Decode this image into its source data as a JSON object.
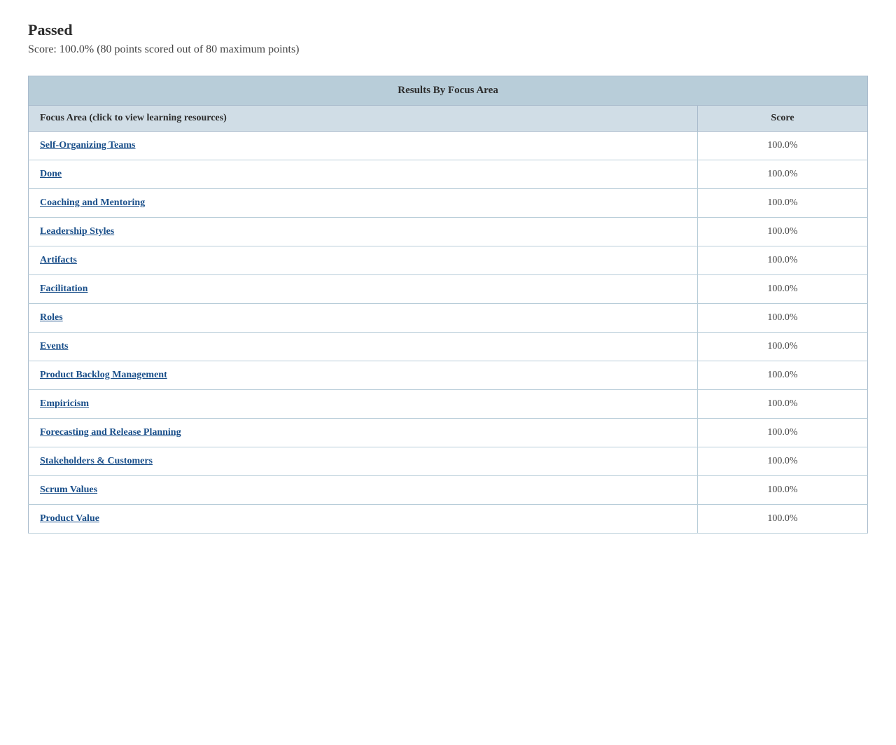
{
  "status": {
    "title": "Passed",
    "score_text": "Score: 100.0% (80 points scored out of 80 maximum points)"
  },
  "table": {
    "section_header": "Results By Focus Area",
    "col_focus_area": "Focus Area (click to view learning resources)",
    "col_score": "Score",
    "rows": [
      {
        "focus_area": "Self-Organizing Teams",
        "score": "100.0%"
      },
      {
        "focus_area": "Done",
        "score": "100.0%"
      },
      {
        "focus_area": "Coaching and Mentoring",
        "score": "100.0%"
      },
      {
        "focus_area": "Leadership Styles",
        "score": "100.0%"
      },
      {
        "focus_area": "Artifacts",
        "score": "100.0%"
      },
      {
        "focus_area": "Facilitation",
        "score": "100.0%"
      },
      {
        "focus_area": "Roles",
        "score": "100.0%"
      },
      {
        "focus_area": "Events",
        "score": "100.0%"
      },
      {
        "focus_area": "Product Backlog Management",
        "score": "100.0%"
      },
      {
        "focus_area": "Empiricism",
        "score": "100.0%"
      },
      {
        "focus_area": "Forecasting and Release Planning",
        "score": "100.0%"
      },
      {
        "focus_area": "Stakeholders & Customers",
        "score": "100.0%"
      },
      {
        "focus_area": "Scrum Values",
        "score": "100.0%"
      },
      {
        "focus_area": "Product Value",
        "score": "100.0%"
      }
    ]
  }
}
